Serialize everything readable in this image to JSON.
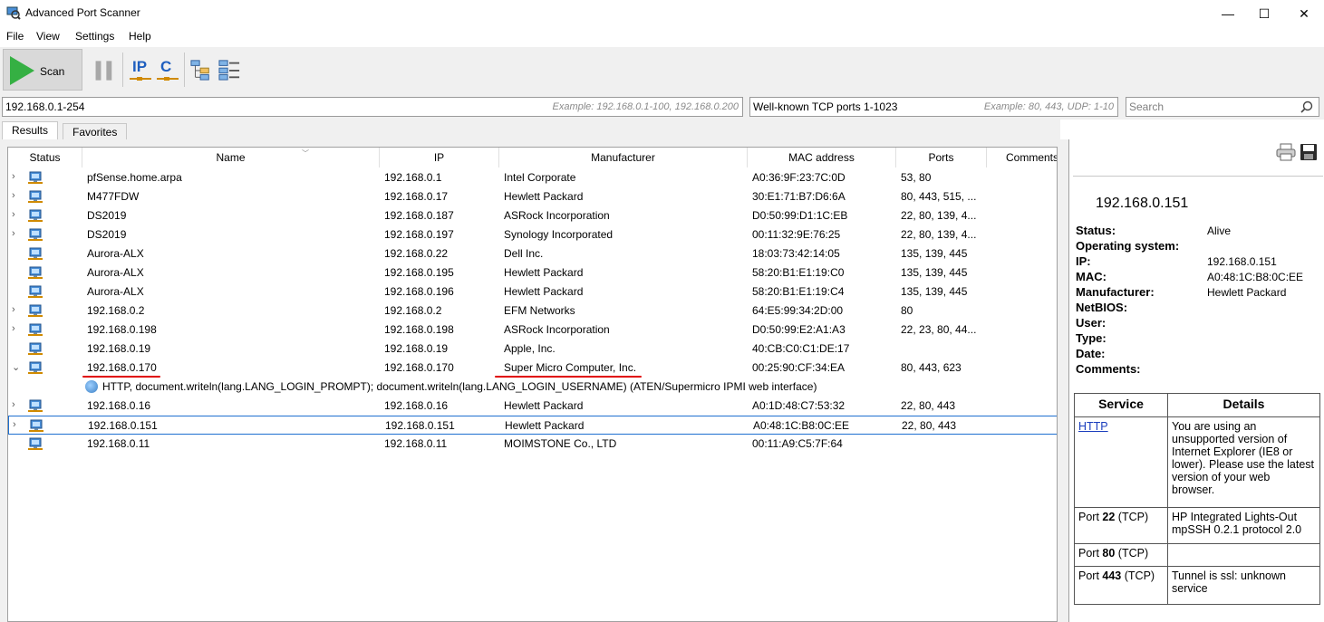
{
  "app": {
    "title": "Advanced Port Scanner"
  },
  "window_controls": {
    "minimize": "—",
    "maximize": "☐",
    "close": "✕"
  },
  "menu": [
    "File",
    "View",
    "Settings",
    "Help"
  ],
  "toolbar": {
    "scan_label": "Scan",
    "ip_label": "IP",
    "c_label": "C"
  },
  "inputs": {
    "ip_range": {
      "value": "192.168.0.1-254",
      "hint": "Example: 192.168.0.1-100, 192.168.0.200"
    },
    "ports": {
      "value": "Well-known TCP ports 1-1023",
      "hint": "Example: 80, 443, UDP: 1-10"
    },
    "search": {
      "placeholder": "Search"
    }
  },
  "tabs": [
    "Results",
    "Favorites"
  ],
  "columns": [
    "Status",
    "Name",
    "IP",
    "Manufacturer",
    "MAC address",
    "Ports",
    "Comments"
  ],
  "rows": [
    {
      "expand": "›",
      "name": "pfSense.home.arpa",
      "ip": "192.168.0.1",
      "manufacturer": "Intel Corporate",
      "mac": "A0:36:9F:23:7C:0D",
      "ports": "53, 80"
    },
    {
      "expand": "›",
      "name": "M477FDW",
      "ip": "192.168.0.17",
      "manufacturer": "Hewlett Packard",
      "mac": "30:E1:71:B7:D6:6A",
      "ports": "80, 443, 515, ..."
    },
    {
      "expand": "›",
      "name": "DS2019",
      "ip": "192.168.0.187",
      "manufacturer": "ASRock Incorporation",
      "mac": "D0:50:99:D1:1C:EB",
      "ports": "22, 80, 139, 4..."
    },
    {
      "expand": "›",
      "name": "DS2019",
      "ip": "192.168.0.197",
      "manufacturer": "Synology Incorporated",
      "mac": "00:11:32:9E:76:25",
      "ports": "22, 80, 139, 4..."
    },
    {
      "expand": "",
      "name": "Aurora-ALX",
      "ip": "192.168.0.22",
      "manufacturer": "Dell Inc.",
      "mac": "18:03:73:42:14:05",
      "ports": "135, 139, 445"
    },
    {
      "expand": "",
      "name": "Aurora-ALX",
      "ip": "192.168.0.195",
      "manufacturer": "Hewlett Packard",
      "mac": "58:20:B1:E1:19:C0",
      "ports": "135, 139, 445"
    },
    {
      "expand": "",
      "name": "Aurora-ALX",
      "ip": "192.168.0.196",
      "manufacturer": "Hewlett Packard",
      "mac": "58:20:B1:E1:19:C4",
      "ports": "135, 139, 445"
    },
    {
      "expand": "›",
      "name": "192.168.0.2",
      "ip": "192.168.0.2",
      "manufacturer": "EFM Networks",
      "mac": "64:E5:99:34:2D:00",
      "ports": "80"
    },
    {
      "expand": "›",
      "name": "192.168.0.198",
      "ip": "192.168.0.198",
      "manufacturer": "ASRock Incorporation",
      "mac": "D0:50:99:E2:A1:A3",
      "ports": "22, 23, 80, 44..."
    },
    {
      "expand": "",
      "name": "192.168.0.19",
      "ip": "192.168.0.19",
      "manufacturer": "Apple, Inc.",
      "mac": "40:CB:C0:C1:DE:17",
      "ports": ""
    },
    {
      "expand": "⌄",
      "name": "192.168.0.170",
      "ip": "192.168.0.170",
      "manufacturer": "Super Micro Computer, Inc.",
      "mac": "00:25:90:CF:34:EA",
      "ports": "80, 443, 623"
    },
    {
      "expand": "›",
      "name": "192.168.0.16",
      "ip": "192.168.0.16",
      "manufacturer": "Hewlett Packard",
      "mac": "A0:1D:48:C7:53:32",
      "ports": "22, 80, 443"
    },
    {
      "expand": "›",
      "name": "192.168.0.151",
      "ip": "192.168.0.151",
      "manufacturer": "Hewlett Packard",
      "mac": "A0:48:1C:B8:0C:EE",
      "ports": "22, 80, 443"
    },
    {
      "expand": "",
      "name": "192.168.0.11",
      "ip": "192.168.0.11",
      "manufacturer": "MOIMSTONE Co., LTD",
      "mac": "00:11:A9:C5:7F:64",
      "ports": ""
    }
  ],
  "expanded_service": "HTTP, document.writeln(lang.LANG_LOGIN_PROMPT); document.writeln(lang.LANG_LOGIN_USERNAME) (ATEN/Supermicro IPMI web interface)",
  "details": {
    "host_ip": "192.168.0.151",
    "props": [
      {
        "label": "Status:",
        "value": "Alive"
      },
      {
        "label": "Operating system:",
        "value": ""
      },
      {
        "label": "IP:",
        "value": "192.168.0.151"
      },
      {
        "label": "MAC:",
        "value": "A0:48:1C:B8:0C:EE"
      },
      {
        "label": "Manufacturer:",
        "value": "Hewlett Packard"
      },
      {
        "label": "NetBIOS:",
        "value": ""
      },
      {
        "label": "User:",
        "value": ""
      },
      {
        "label": "Type:",
        "value": ""
      },
      {
        "label": "Date:",
        "value": ""
      },
      {
        "label": "Comments:",
        "value": ""
      }
    ],
    "table_headers": {
      "service": "Service",
      "details": "Details"
    },
    "services": [
      {
        "service": "HTTP",
        "port": "",
        "proto": "",
        "details": "You are using an unsupported version of Internet Explorer (IE8 or lower). Please use the latest version of your web browser."
      },
      {
        "service": "Port ",
        "port": "22",
        "proto": " (TCP)",
        "details": "HP Integrated Lights-Out mpSSH 0.2.1 protocol 2.0"
      },
      {
        "service": "Port ",
        "port": "80",
        "proto": " (TCP)",
        "details": ""
      },
      {
        "service": "Port ",
        "port": "443",
        "proto": " (TCP)",
        "details": "Tunnel is ssl: unknown service"
      }
    ]
  },
  "colors": {
    "accent_green": "#35b043",
    "ip_icon_blue": "#1f5fbf",
    "annotation_red": "#e00000",
    "selection_blue": "#1e6fd0"
  }
}
